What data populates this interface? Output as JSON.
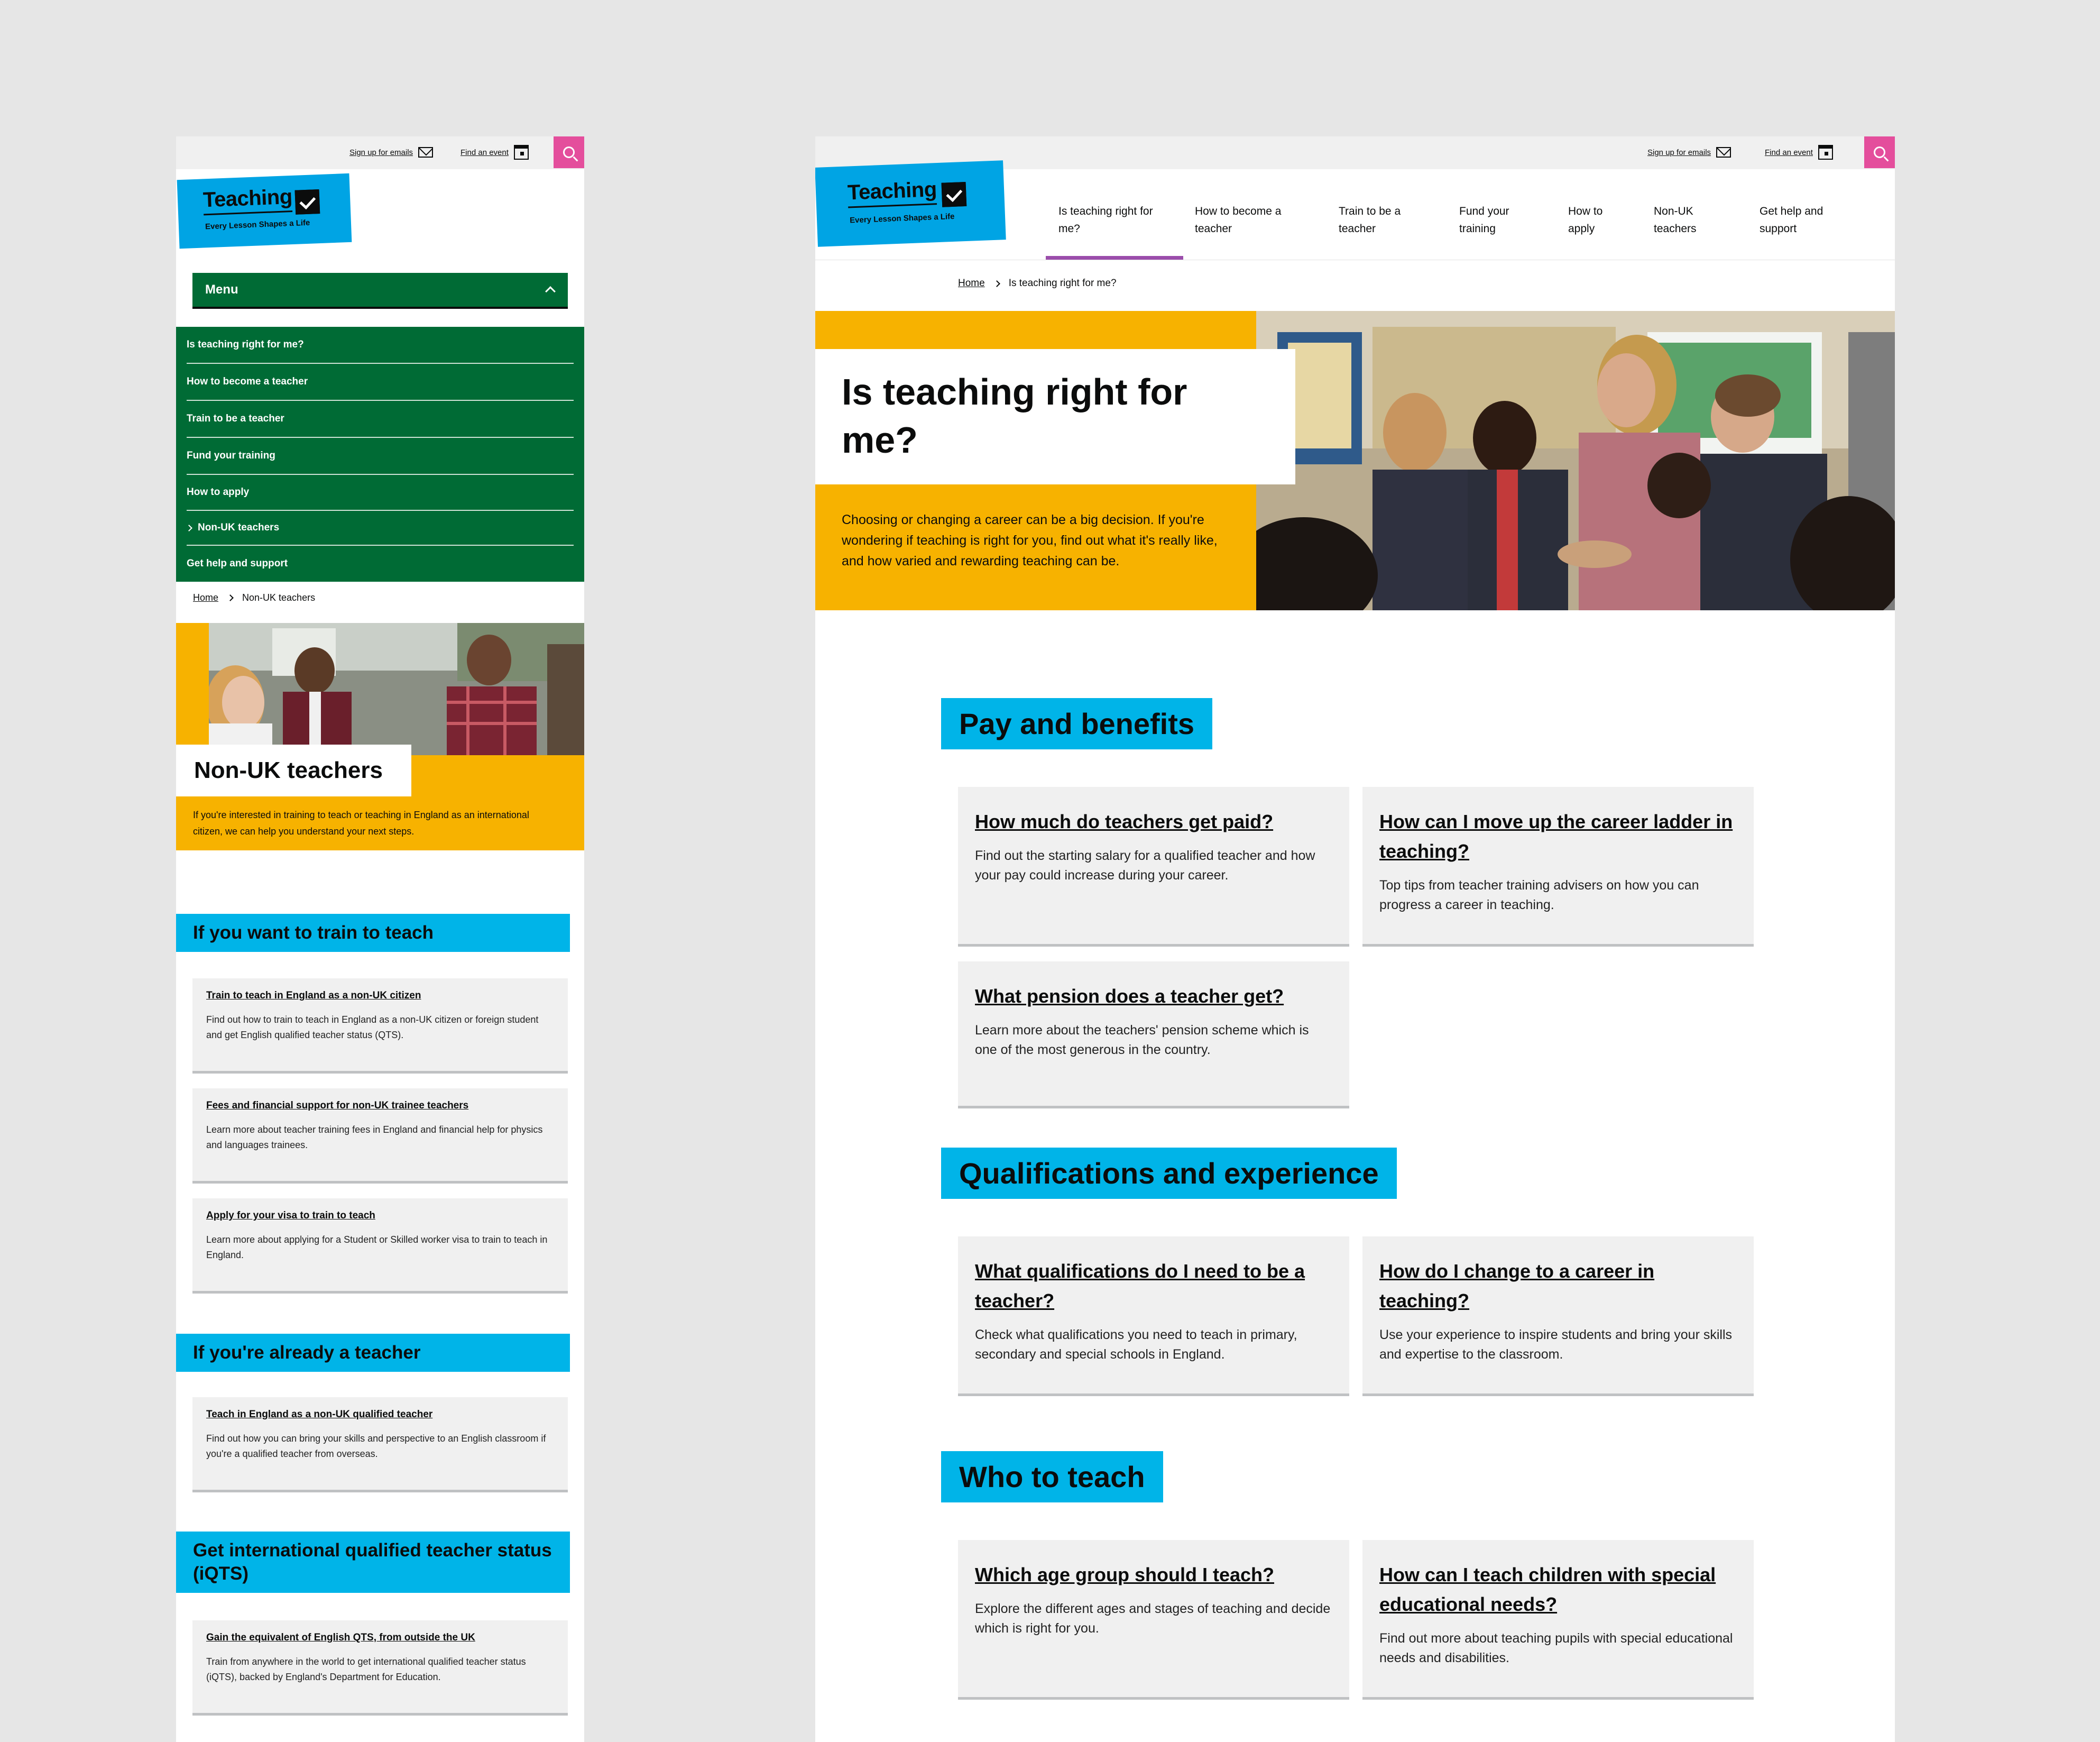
{
  "utility": {
    "signup": "Sign up for emails",
    "event": "Find an event"
  },
  "logo": {
    "word": "Teaching",
    "tagline": "Every Lesson Shapes a Life"
  },
  "mobile": {
    "menu_label": "Menu",
    "menu_items": [
      "Is teaching right for me?",
      "How to become a teacher",
      "Train to be a teacher",
      "Fund your training",
      "How to apply",
      "Non-UK teachers",
      "Get help and support"
    ],
    "breadcrumb_home": "Home",
    "breadcrumb_current": "Non-UK teachers",
    "page_title": "Non-UK teachers",
    "intro": "If you're interested in training to teach or teaching in England as an international citizen, we can help you understand your next steps.",
    "sections": [
      {
        "heading": "If you want to train to teach",
        "cards": [
          {
            "title": "Train to teach in England as a non-UK citizen",
            "desc": "Find out how to train to teach in England as a non-UK citizen or foreign student and get English qualified teacher status (QTS)."
          },
          {
            "title": "Fees and financial support for non-UK trainee teachers",
            "desc": "Learn more about teacher training fees in England and financial help for physics and languages trainees."
          },
          {
            "title": "Apply for your visa to train to teach",
            "desc": "Learn more about applying for a Student or Skilled worker visa to train to teach in England."
          }
        ]
      },
      {
        "heading": "If you're already a teacher",
        "cards": [
          {
            "title": "Teach in England as a non-UK qualified teacher",
            "desc": "Find out how you can bring your skills and perspective to an English classroom if you're a qualified teacher from overseas."
          }
        ]
      },
      {
        "heading": "Get international qualified teacher status (iQTS)",
        "cards": [
          {
            "title": "Gain the equivalent of English QTS, from outside the UK",
            "desc": "Train from anywhere in the world to get international qualified teacher status (iQTS), backed by England's Department for Education."
          }
        ]
      }
    ]
  },
  "desktop": {
    "nav": [
      "Is teaching right for me?",
      "How to become a teacher",
      "Train to be a teacher",
      "Fund your training",
      "How to apply",
      "Non-UK teachers",
      "Get help and support"
    ],
    "breadcrumb_home": "Home",
    "breadcrumb_current": "Is teaching right for me?",
    "page_title": "Is teaching right for me?",
    "intro": "Choosing or changing a career can be a big decision. If you're wondering if teaching is right for you, find out what it's really like, and how varied and rewarding teaching can be.",
    "sections": [
      {
        "heading": "Pay and benefits",
        "cards": [
          {
            "title": "How much do teachers get paid?",
            "desc": "Find out the starting salary for a qualified teacher and how your pay could increase during your career."
          },
          {
            "title": "How can I move up the career ladder in teaching?",
            "desc": "Top tips from teacher training advisers on how you can progress a career in teaching."
          },
          {
            "title": "What pension does a teacher get?",
            "desc": "Learn more about the teachers' pension scheme which is one of the most generous in the country."
          }
        ]
      },
      {
        "heading": "Qualifications and experience",
        "cards": [
          {
            "title": "What qualifications do I need to be a teacher?",
            "desc": "Check what qualifications you need to teach in primary, secondary and special schools in England."
          },
          {
            "title": "How do I change to a career in teaching?",
            "desc": "Use your experience to inspire students and bring your skills and expertise to the classroom."
          }
        ]
      },
      {
        "heading": "Who to teach",
        "cards": [
          {
            "title": "Which age group should I teach?",
            "desc": "Explore the different ages and stages of teaching and decide which is right for you."
          },
          {
            "title": "How can I teach children with special educational needs?",
            "desc": "Find out more about teaching pupils with special educational needs and disabilities."
          }
        ]
      }
    ]
  },
  "colors": {
    "brand_blue": "#00a4e4",
    "section_blue": "#00b4e8",
    "menu_green": "#006b35",
    "accent_yellow": "#f7b200",
    "search_pink": "#e44e9c",
    "nav_active": "#9b4dab"
  }
}
